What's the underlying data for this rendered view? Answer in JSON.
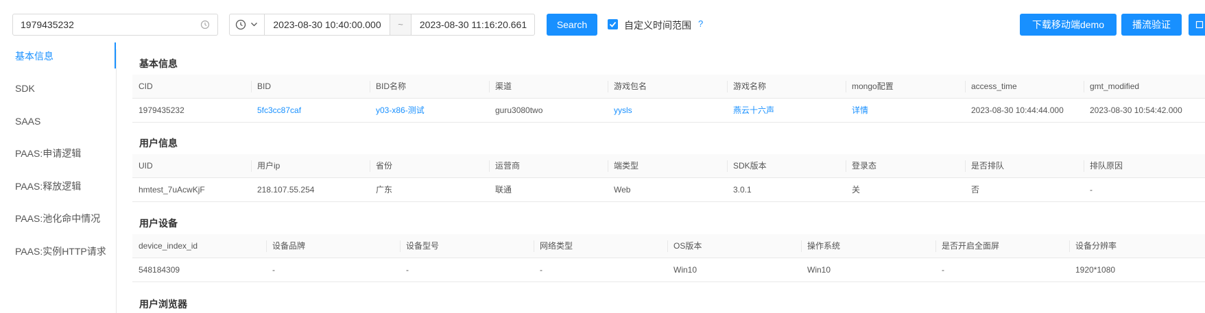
{
  "toolbar": {
    "cid_value": "1979435232",
    "range_start": "2023-08-30 10:40:00.000",
    "range_separator": "~",
    "range_end": "2023-08-30 11:16:20.661",
    "search_label": "Search",
    "custom_range_label": "自定义时间范围",
    "custom_range_checked": true,
    "help_label": "?",
    "demo_label": "下载移动端demo",
    "verify_label": "播流验证",
    "accent_color": "#1890ff"
  },
  "sidebar": {
    "items": [
      {
        "label": "基本信息",
        "active": true
      },
      {
        "label": "SDK",
        "active": false
      },
      {
        "label": "SAAS",
        "active": false
      },
      {
        "label": "PAAS:申请逻辑",
        "active": false
      },
      {
        "label": "PAAS:释放逻辑",
        "active": false
      },
      {
        "label": "PAAS:池化命中情况",
        "active": false
      },
      {
        "label": "PAAS:实例HTTP请求",
        "active": false
      }
    ]
  },
  "sections": {
    "basic": {
      "title": "基本信息",
      "headers": [
        "CID",
        "BID",
        "BID名称",
        "渠道",
        "游戏包名",
        "游戏名称",
        "mongo配置",
        "access_time",
        "gmt_modified"
      ],
      "row": [
        "1979435232",
        "5fc3cc87caf",
        "y03-x86-测试",
        "guru3080two",
        "yysls",
        "燕云十六声",
        "详情",
        "2023-08-30 10:44:44.000",
        "2023-08-30 10:54:42.000"
      ]
    },
    "user": {
      "title": "用户信息",
      "headers": [
        "UID",
        "用户ip",
        "省份",
        "运营商",
        "端类型",
        "SDK版本",
        "登录态",
        "是否排队",
        "排队原因"
      ],
      "row": [
        "hmtest_7uAcwKjF",
        "218.107.55.254",
        "广东",
        "联通",
        "Web",
        "3.0.1",
        "关",
        "否",
        "-"
      ]
    },
    "device": {
      "title": "用户设备",
      "headers": [
        "device_index_id",
        "设备品牌",
        "设备型号",
        "网络类型",
        "OS版本",
        "操作系统",
        "是否开启全面屏",
        "设备分辨率"
      ],
      "row": [
        "548184309",
        "-",
        "-",
        "-",
        "Win10",
        "Win10",
        "-",
        "1920*1080"
      ]
    },
    "browser": {
      "title": "用户浏览器"
    }
  }
}
